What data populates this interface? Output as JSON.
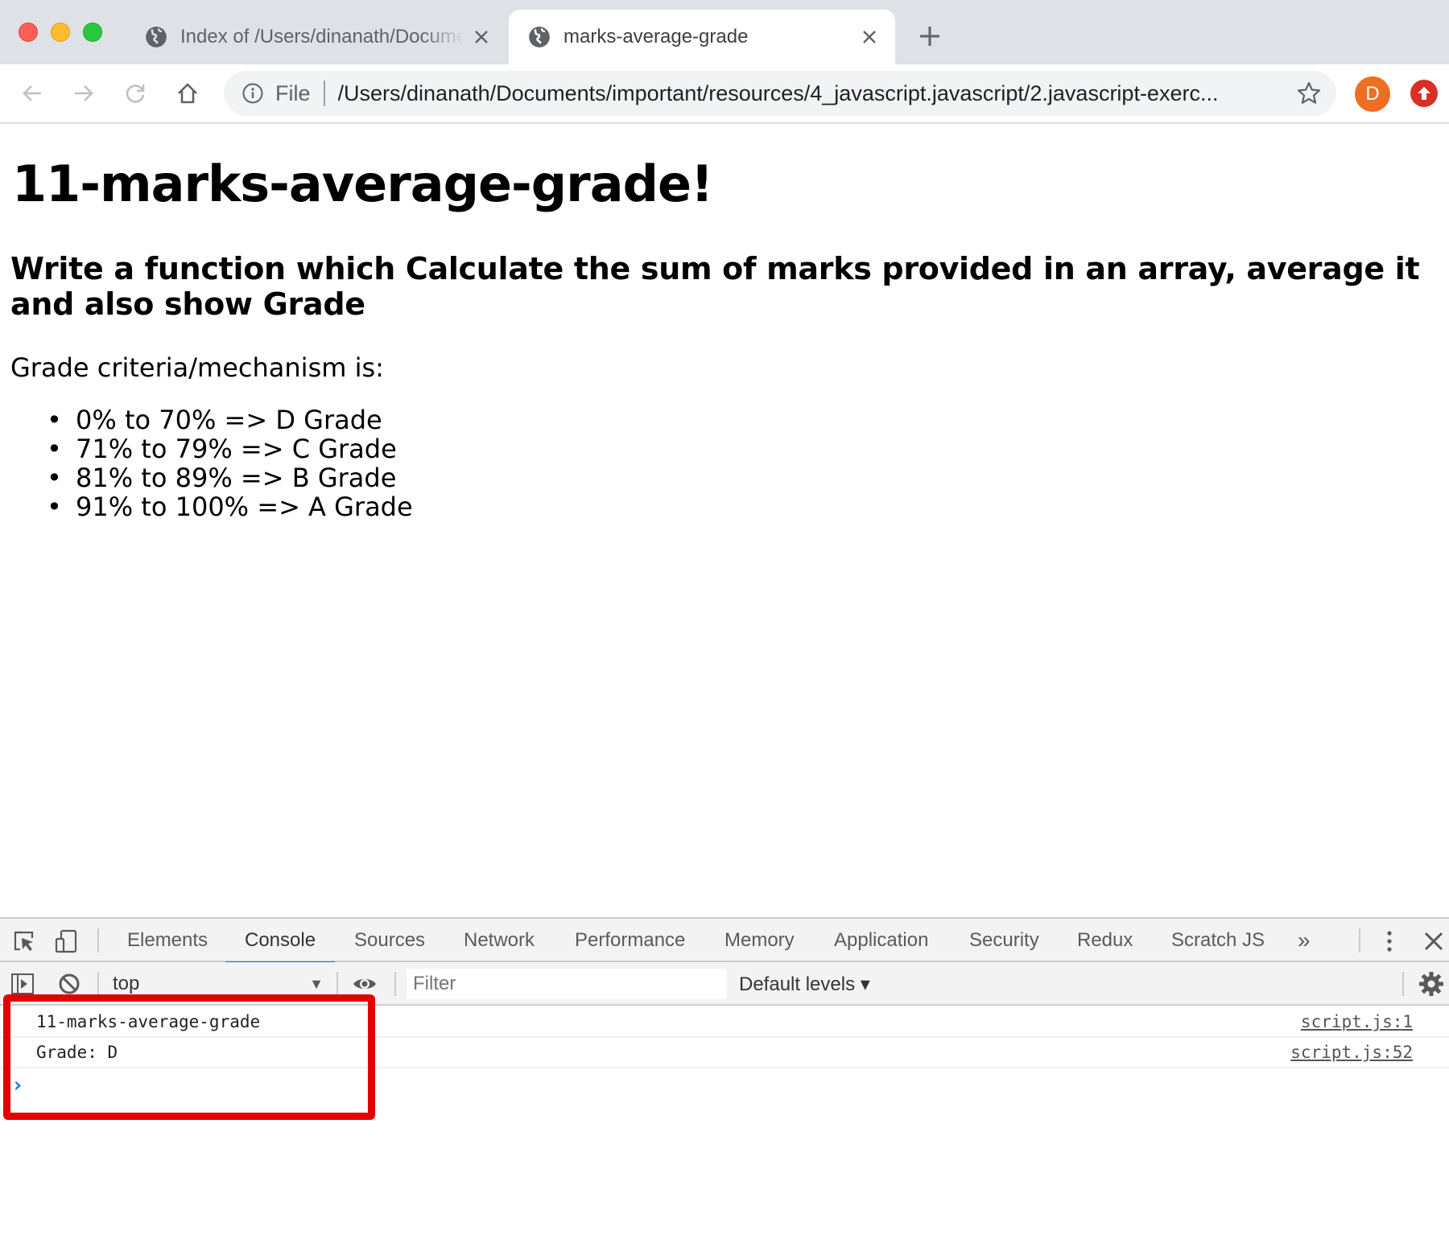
{
  "window": {
    "controls": [
      "close",
      "minimize",
      "maximize"
    ]
  },
  "tabs": [
    {
      "title": "Index of /Users/dinanath/Documents",
      "icon": "globe-icon",
      "active": false
    },
    {
      "title": "marks-average-grade",
      "icon": "globe-icon",
      "active": true
    }
  ],
  "toolbar": {
    "back_icon": "arrow-left",
    "forward_icon": "arrow-right",
    "reload_icon": "reload",
    "home_icon": "home",
    "scheme_label": "File",
    "url": "/Users/dinanath/Documents/important/resources/4_javascript.javascript/2.javascript-exerc...",
    "profile_initial": "D",
    "profile_color": "#ee6e22",
    "update_color": "#d93025"
  },
  "page": {
    "heading": "11-marks-average-grade!",
    "subheading": "Write a function which Calculate the sum of marks provided in an array, average it and also show Grade",
    "criteria_intro": "Grade criteria/mechanism is:",
    "criteria": [
      "0% to 70% => D Grade",
      "71% to 79% => C Grade",
      "81% to 89% => B Grade",
      "91% to 100% => A Grade"
    ]
  },
  "devtools": {
    "tabs": [
      "Elements",
      "Console",
      "Sources",
      "Network",
      "Performance",
      "Memory",
      "Application",
      "Security",
      "Redux",
      "Scratch JS"
    ],
    "active_tab": "Console",
    "more_tabs_label": "»",
    "context": "top",
    "filter_placeholder": "Filter",
    "levels_label": "Default levels ▾",
    "messages": [
      {
        "text": "11-marks-average-grade",
        "source": "script.js:1"
      },
      {
        "text": "Grade: D",
        "source": "script.js:52"
      }
    ],
    "accent_color": "#1a73e8",
    "highlight_color": "#e30000"
  }
}
